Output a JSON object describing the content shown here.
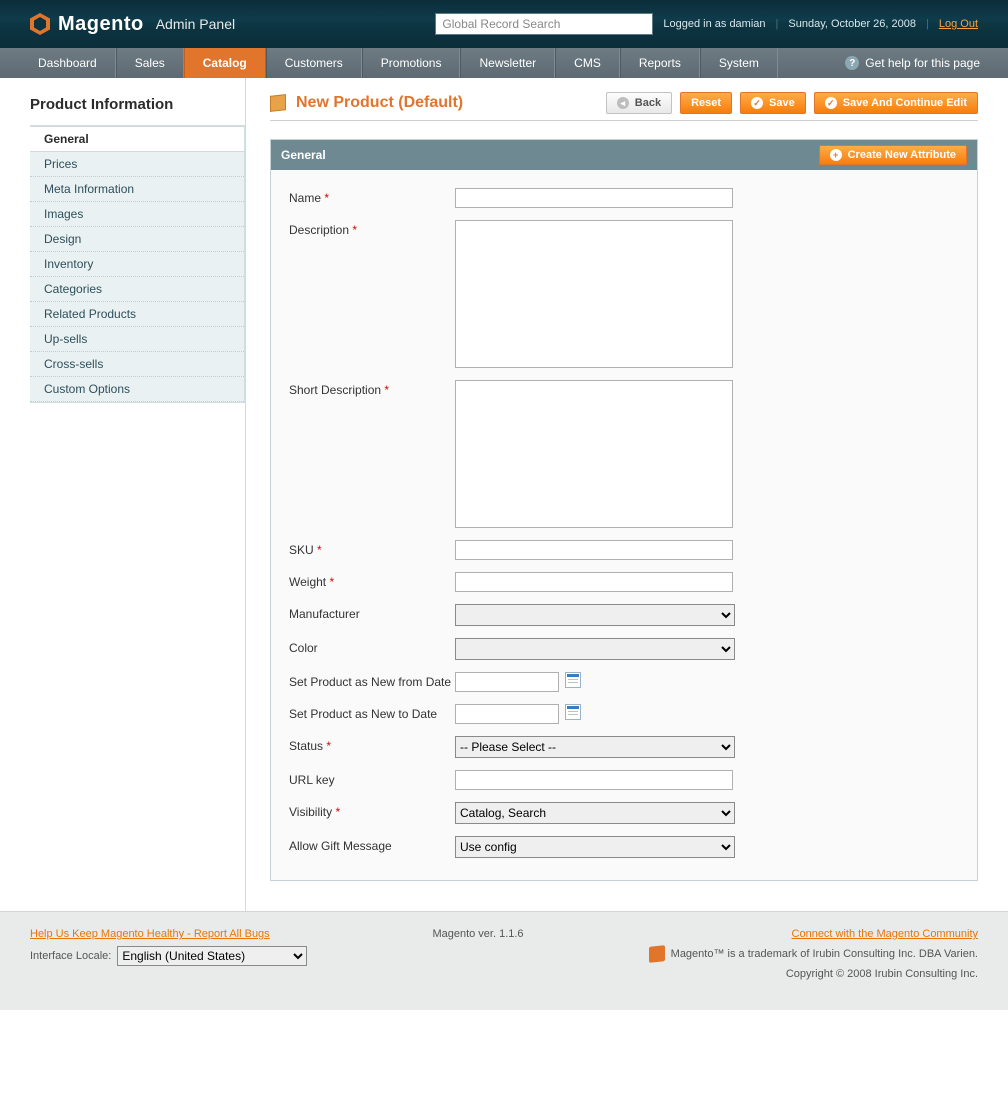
{
  "header": {
    "brand": "Magento",
    "brand_suffix": "™",
    "subtitle": "Admin Panel",
    "search_placeholder": "Global Record Search",
    "logged_in": "Logged in as damian",
    "date": "Sunday, October 26, 2008",
    "logout": "Log Out"
  },
  "nav": {
    "items": [
      "Dashboard",
      "Sales",
      "Catalog",
      "Customers",
      "Promotions",
      "Newsletter",
      "CMS",
      "Reports",
      "System"
    ],
    "active_index": 2,
    "help": "Get help for this page"
  },
  "sidebar": {
    "title": "Product Information",
    "items": [
      "General",
      "Prices",
      "Meta Information",
      "Images",
      "Design",
      "Inventory",
      "Categories",
      "Related Products",
      "Up-sells",
      "Cross-sells",
      "Custom Options"
    ],
    "active_index": 0
  },
  "page": {
    "title": "New Product (Default)",
    "buttons": {
      "back": "Back",
      "reset": "Reset",
      "save": "Save",
      "save_continue": "Save And Continue Edit"
    }
  },
  "panel": {
    "title": "General",
    "create_attr": "Create New Attribute",
    "fields": {
      "name": "Name",
      "description": "Description",
      "short_description": "Short Description",
      "sku": "SKU",
      "weight": "Weight",
      "manufacturer": "Manufacturer",
      "color": "Color",
      "new_from": "Set Product as New from Date",
      "new_to": "Set Product as New to Date",
      "status": "Status",
      "url_key": "URL key",
      "visibility": "Visibility",
      "gift": "Allow Gift Message"
    },
    "values": {
      "status_selected": "-- Please Select --",
      "visibility_selected": "Catalog, Search",
      "gift_selected": "Use config"
    }
  },
  "footer": {
    "bugs": "Help Us Keep Magento Healthy - Report All Bugs",
    "locale_label": "Interface Locale:",
    "locale_value": "English (United States)",
    "version": "Magento ver. 1.1.6",
    "community": "Connect with the Magento Community",
    "trademark": "Magento™ is a trademark of Irubin Consulting Inc. DBA Varien.",
    "copyright": "Copyright © 2008 Irubin Consulting Inc."
  }
}
